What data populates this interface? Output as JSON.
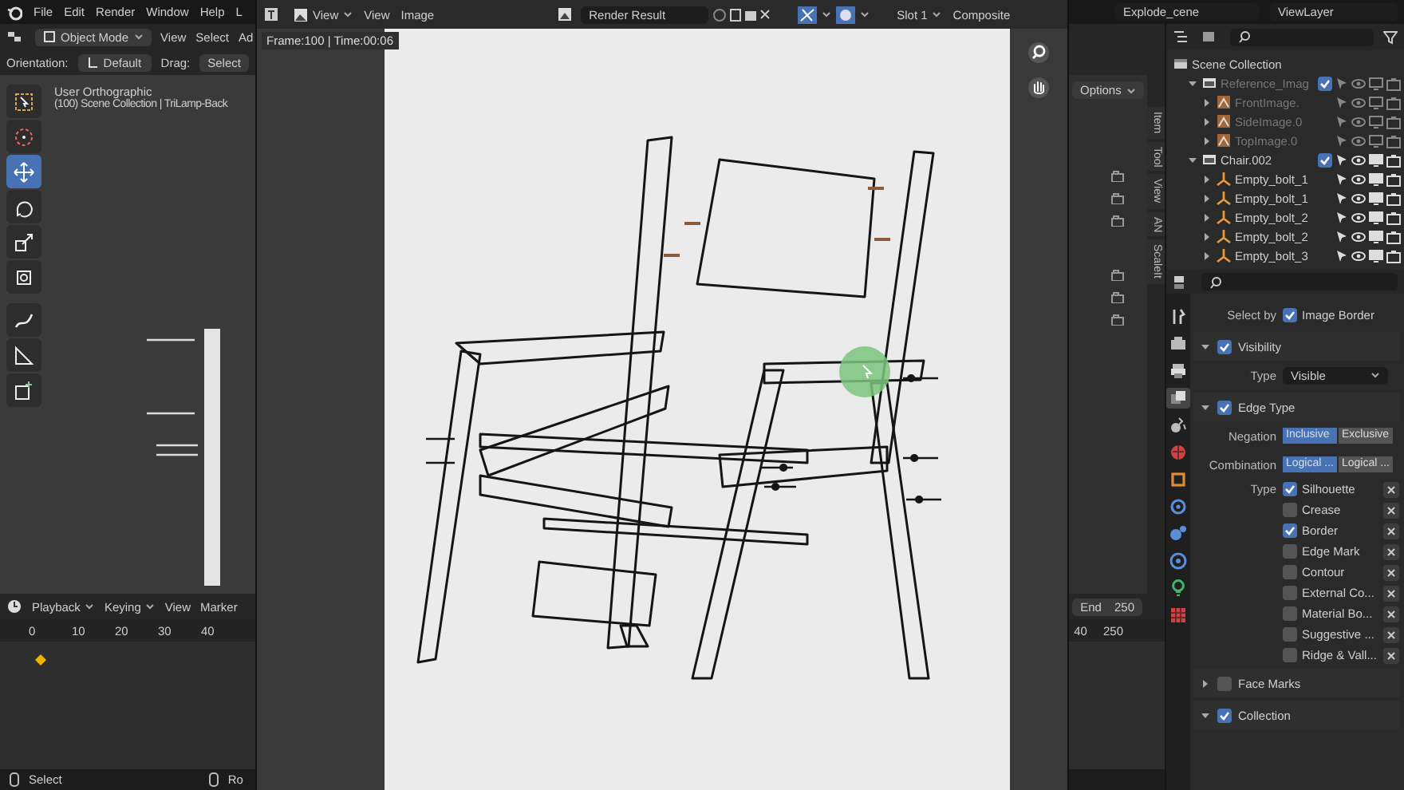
{
  "top_bar": {
    "menus": [
      "File",
      "Edit",
      "Render",
      "Window",
      "Help"
    ],
    "workspace_tab": "L",
    "scene": "Explode_cene",
    "view_layer": "ViewLayer"
  },
  "viewport": {
    "mode": "Object Mode",
    "menus": [
      "View",
      "Select",
      "Ad"
    ],
    "orientation_label": "Orientation:",
    "orientation": "Default",
    "drag_label": "Drag:",
    "drag": "Select",
    "view_name": "User Orthographic",
    "collection_info": "(100) Scene Collection | TriLamp-Back",
    "options": "Options",
    "sidebar_tabs": [
      "Item",
      "Tool",
      "View",
      "AN",
      "ScaleIt"
    ],
    "tools": [
      {
        "kind": "select",
        "selected": false
      },
      {
        "kind": "cursor",
        "selected": false
      },
      {
        "kind": "move",
        "selected": true
      },
      {
        "kind": "rotate",
        "selected": false
      },
      {
        "kind": "scale",
        "selected": false
      },
      {
        "kind": "transform",
        "selected": false
      },
      {
        "kind": "annotate",
        "selected": false
      },
      {
        "kind": "measure",
        "selected": false
      },
      {
        "kind": "add",
        "selected": false
      }
    ]
  },
  "image_editor": {
    "menus": [
      "View",
      "View",
      "Image"
    ],
    "image": "Render Result",
    "slot": "Slot 1",
    "layer": "Composite",
    "frame_info": "Frame:100 | Time:00:06"
  },
  "timeline": {
    "menus": [
      "Playback",
      "Keying",
      "View",
      "Marker"
    ],
    "ticks": [
      "0",
      "10",
      "20",
      "30",
      "40"
    ],
    "end_label": "End",
    "end": "250",
    "end_ticks": [
      "40",
      "250"
    ]
  },
  "status_bar": [
    "Select",
    "Ro"
  ],
  "outliner": {
    "items": [
      {
        "label": "Scene Collection",
        "kind": "scene",
        "children": [
          {
            "label": "Reference_Imag",
            "kind": "collection",
            "checked": true,
            "disabled": true,
            "expanded": true,
            "children": [
              {
                "label": "FrontImage.",
                "kind": "image",
                "disabled": true,
                "expanded": false
              },
              {
                "label": "SideImage.0",
                "kind": "image",
                "disabled": true,
                "expanded": false
              },
              {
                "label": "TopImage.0",
                "kind": "image",
                "disabled": true,
                "expanded": false
              }
            ]
          },
          {
            "label": "Chair.002",
            "kind": "collection",
            "checked": true,
            "disabled": false,
            "expanded": true,
            "children": [
              {
                "label": "Empty_bolt_1",
                "kind": "empty",
                "disabled": false,
                "expanded": false
              },
              {
                "label": "Empty_bolt_1",
                "kind": "empty",
                "disabled": false,
                "expanded": false
              },
              {
                "label": "Empty_bolt_2",
                "kind": "empty",
                "disabled": false,
                "expanded": false
              },
              {
                "label": "Empty_bolt_2",
                "kind": "empty",
                "disabled": false,
                "expanded": false
              },
              {
                "label": "Empty_bolt_3",
                "kind": "empty",
                "disabled": false,
                "expanded": false
              }
            ]
          }
        ]
      }
    ]
  },
  "properties": {
    "tabs": [
      {
        "kind": "tool",
        "selected": false
      },
      {
        "kind": "render",
        "selected": false
      },
      {
        "kind": "output",
        "selected": false
      },
      {
        "kind": "view_layer",
        "selected": true
      },
      {
        "kind": "scene",
        "selected": false
      },
      {
        "kind": "world",
        "selected": false
      },
      {
        "kind": "object",
        "selected": false
      },
      {
        "kind": "modifiers",
        "selected": false
      },
      {
        "kind": "particles",
        "selected": false
      },
      {
        "kind": "physics",
        "selected": false
      },
      {
        "kind": "data",
        "selected": false
      },
      {
        "kind": "texture",
        "selected": false
      }
    ],
    "rows": [
      {
        "kind": "check",
        "label": "Select by",
        "text": "Image Border",
        "checked": true
      },
      {
        "kind": "panel",
        "text": "Visibility",
        "checked": true,
        "expanded": true
      },
      {
        "kind": "select",
        "label": "Type",
        "value": "Visible"
      },
      {
        "kind": "panel",
        "text": "Edge Type",
        "checked": true,
        "expanded": true
      },
      {
        "kind": "segmented",
        "label": "Negation",
        "options": [
          {
            "label": "Inclusive",
            "selected": true
          },
          {
            "label": "Exclusive",
            "selected": false
          }
        ]
      },
      {
        "kind": "segmented",
        "label": "Combination",
        "options": [
          {
            "label": "Logical ...",
            "selected": true
          },
          {
            "label": "Logical ...",
            "selected": false
          }
        ]
      },
      {
        "kind": "typecheck",
        "label": "Type",
        "text": "Silhouette",
        "checked": true
      },
      {
        "kind": "typecheck",
        "text": "Crease",
        "checked": false
      },
      {
        "kind": "typecheck",
        "text": "Border",
        "checked": true
      },
      {
        "kind": "typecheck",
        "text": "Edge Mark",
        "checked": false
      },
      {
        "kind": "typecheck",
        "text": "Contour",
        "checked": false
      },
      {
        "kind": "typecheck",
        "text": "External Co...",
        "checked": false
      },
      {
        "kind": "typecheck",
        "text": "Material Bo...",
        "checked": false
      },
      {
        "kind": "typecheck",
        "text": "Suggestive ...",
        "checked": false
      },
      {
        "kind": "typecheck",
        "text": "Ridge & Vall...",
        "checked": false
      },
      {
        "kind": "panel",
        "text": "Face Marks",
        "checked": false,
        "expanded": false
      },
      {
        "kind": "panel",
        "text": "Collection",
        "checked": true,
        "expanded": true
      }
    ]
  }
}
